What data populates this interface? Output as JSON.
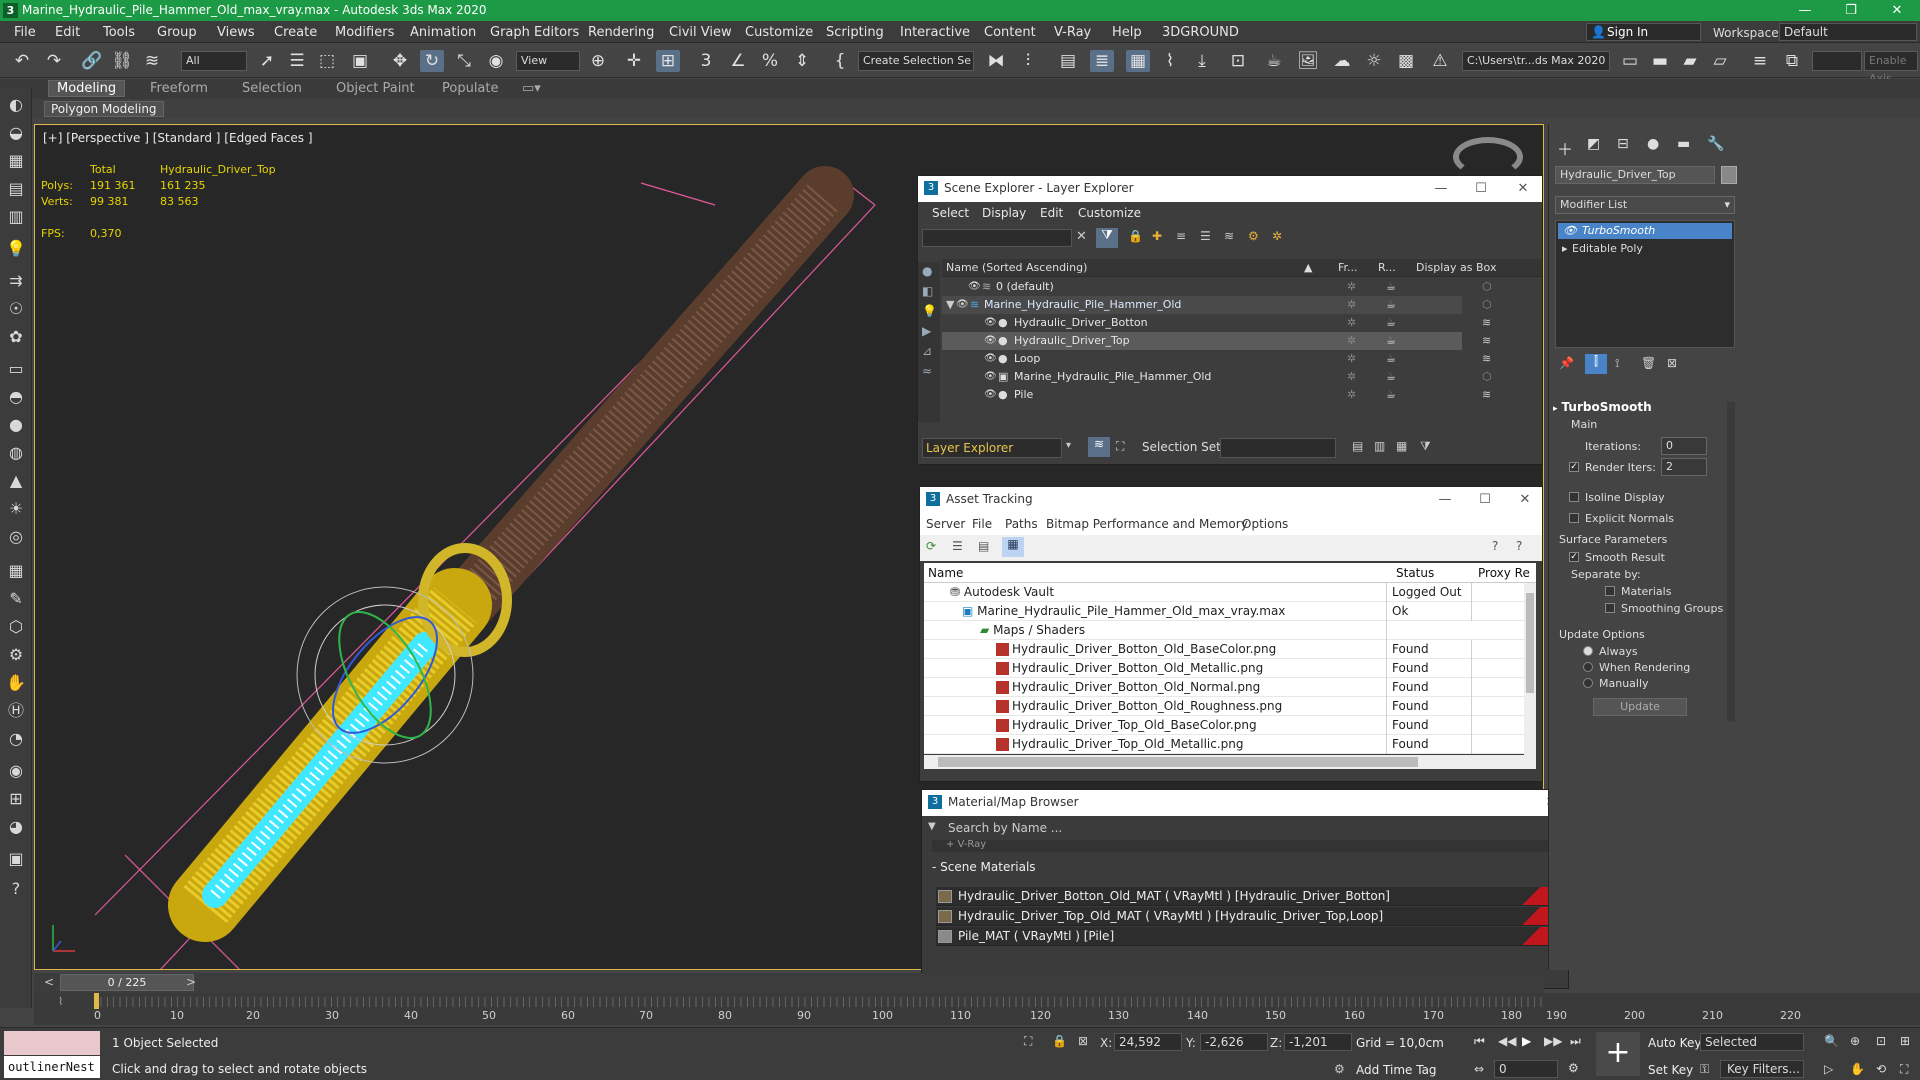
{
  "app": {
    "title": "Marine_Hydraulic_Pile_Hammer_Old_max_vray.max - Autodesk 3ds Max 2020",
    "logo": "3",
    "window_controls": [
      "—",
      "❐",
      "✕"
    ]
  },
  "menu": [
    "File",
    "Edit",
    "Tools",
    "Group",
    "Views",
    "Create",
    "Modifiers",
    "Animation",
    "Graph Editors",
    "Rendering",
    "Civil View",
    "Customize",
    "Scripting",
    "Interactive",
    "Content",
    "V-Ray",
    "Help",
    "3DGROUND"
  ],
  "account": {
    "sign_in": "Sign In",
    "workspaces_label": "Workspaces:",
    "workspace": "Default"
  },
  "toolbar": {
    "filter": "All",
    "view": "View",
    "selection_set": "Create Selection Se",
    "path": "C:\\Users\\tr...ds Max 2020",
    "enable_axis": "Enable Axis"
  },
  "ribbon": {
    "tabs": [
      "Modeling",
      "Freeform",
      "Selection",
      "Object Paint",
      "Populate"
    ],
    "active_tab": "Modeling",
    "sub_label": "Polygon Modeling"
  },
  "viewport": {
    "label": "[+] [Perspective ] [Standard ] [Edged Faces ]",
    "stats": {
      "col_total": "Total",
      "col_selected": "Hydraulic_Driver_Top",
      "polys_label": "Polys:",
      "polys_total": "191 361",
      "polys_sel": "161 235",
      "verts_label": "Verts:",
      "verts_total": "99 381",
      "verts_sel": "83 563",
      "fps_label": "FPS:",
      "fps": "0,370"
    }
  },
  "scene_explorer": {
    "title": "Scene Explorer - Layer Explorer",
    "menu": [
      "Select",
      "Display",
      "Edit",
      "Customize"
    ],
    "columns": [
      "Name (Sorted Ascending)",
      "Fr...",
      "R...",
      "Display as Box"
    ],
    "rows": [
      {
        "name": "0 (default)",
        "indent": 0
      },
      {
        "name": "Marine_Hydraulic_Pile_Hammer_Old",
        "indent": 0
      },
      {
        "name": "Hydraulic_Driver_Botton",
        "indent": 1
      },
      {
        "name": "Hydraulic_Driver_Top",
        "indent": 1
      },
      {
        "name": "Loop",
        "indent": 1
      },
      {
        "name": "Marine_Hydraulic_Pile_Hammer_Old",
        "indent": 1
      },
      {
        "name": "Pile",
        "indent": 1
      }
    ],
    "footer_mode": "Layer Explorer",
    "selection_set_label": "Selection Set:"
  },
  "asset_tracking": {
    "title": "Asset Tracking",
    "menu": [
      "Server",
      "File",
      "Paths",
      "Bitmap Performance and Memory",
      "Options"
    ],
    "columns": [
      "Name",
      "Status",
      "Proxy Re"
    ],
    "rows": [
      {
        "name": "Autodesk Vault",
        "status": "Logged Out ..."
      },
      {
        "name": "Marine_Hydraulic_Pile_Hammer_Old_max_vray.max",
        "status": "Ok"
      },
      {
        "name": "Maps / Shaders",
        "status": ""
      },
      {
        "name": "Hydraulic_Driver_Botton_Old_BaseColor.png",
        "status": "Found"
      },
      {
        "name": "Hydraulic_Driver_Botton_Old_Metallic.png",
        "status": "Found"
      },
      {
        "name": "Hydraulic_Driver_Botton_Old_Normal.png",
        "status": "Found"
      },
      {
        "name": "Hydraulic_Driver_Botton_Old_Roughness.png",
        "status": "Found"
      },
      {
        "name": "Hydraulic_Driver_Top_Old_BaseColor.png",
        "status": "Found"
      },
      {
        "name": "Hydraulic_Driver_Top_Old_Metallic.png",
        "status": "Found"
      }
    ]
  },
  "material_browser": {
    "title": "Material/Map Browser",
    "search_placeholder": "Search by Name ...",
    "collapsed_group": "+ V-Ray",
    "group": "- Scene Materials",
    "materials": [
      "Hydraulic_Driver_Botton_Old_MAT ( VRayMtl ) [Hydraulic_Driver_Botton]",
      "Hydraulic_Driver_Top_Old_MAT ( VRayMtl ) [Hydraulic_Driver_Top,Loop]",
      "Pile_MAT ( VRayMtl ) [Pile]"
    ]
  },
  "command_panel": {
    "object_name": "Hydraulic_Driver_Top",
    "modifier_list": "Modifier List",
    "stack": [
      "TurboSmooth",
      "Editable Poly"
    ],
    "rollout_title": "TurboSmooth",
    "main_label": "Main",
    "iterations_label": "Iterations:",
    "iterations": "0",
    "render_iters_label": "Render Iters:",
    "render_iters": "2",
    "isoline": "Isoline Display",
    "explicit_normals": "Explicit Normals",
    "surface_params": "Surface Parameters",
    "smooth_result": "Smooth Result",
    "separate_by": "Separate by:",
    "materials": "Materials",
    "smoothing_groups": "Smoothing Groups",
    "update_options": "Update Options",
    "always": "Always",
    "when_rendering": "When Rendering",
    "manually": "Manually",
    "update_button": "Update"
  },
  "timeline": {
    "frame": "0 / 225",
    "ticks": [
      "0",
      "10",
      "20",
      "30",
      "40",
      "50",
      "60",
      "70",
      "80",
      "90",
      "100",
      "110",
      "120",
      "130",
      "140",
      "150",
      "160",
      "170",
      "180",
      "190",
      "200",
      "210",
      "220"
    ]
  },
  "status": {
    "maxscript": "outlinerNest",
    "selected": "1 Object Selected",
    "prompt": "Click and drag to select and rotate objects",
    "x_label": "X:",
    "x": "24,592",
    "y_label": "Y:",
    "y": "-2,626",
    "z_label": "Z:",
    "z": "-1,201",
    "grid": "Grid = 10,0cm",
    "add_time_tag": "Add Time Tag",
    "auto_key": "Auto Key",
    "set_key": "Set Key",
    "key_mode": "Selected",
    "key_filters": "Key Filters...",
    "frame_field": "0"
  },
  "colors": {
    "titlebar": "#1c9a45",
    "viewport_border": "#e0b84a",
    "stats_text": "#e6d400",
    "selection_cyan": "#3fe8ff",
    "pile_brown": "#6b4a36",
    "material_red": "#c0161c"
  }
}
